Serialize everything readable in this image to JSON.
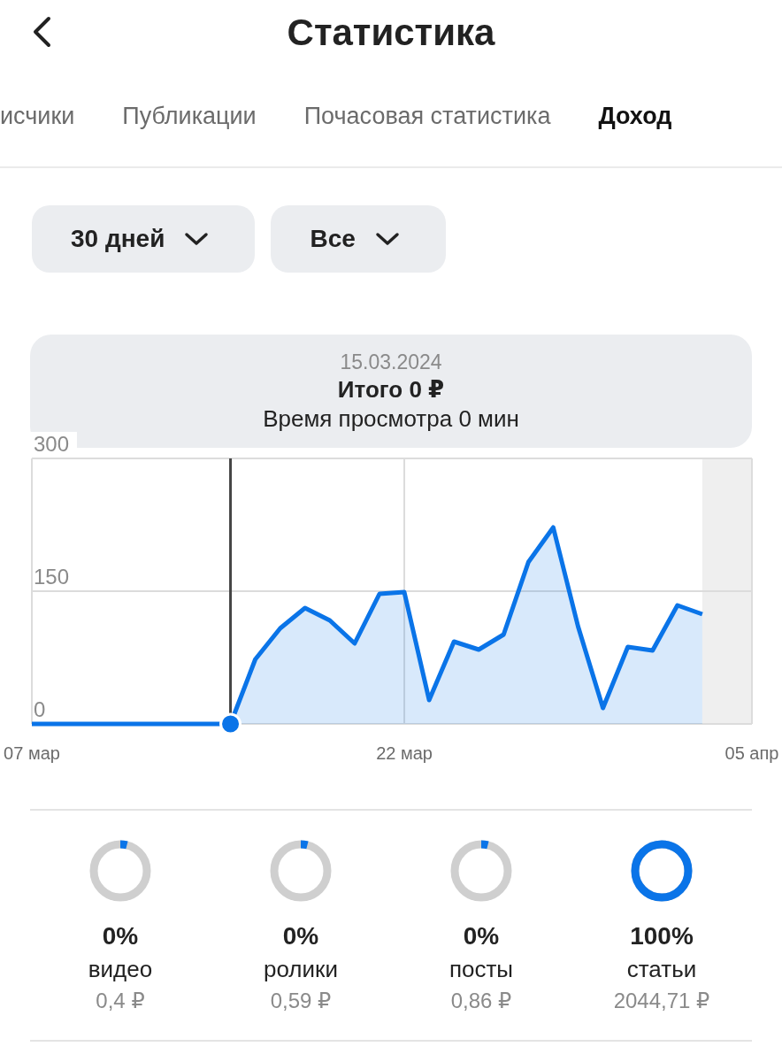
{
  "header": {
    "title": "Статистика"
  },
  "tabs": [
    {
      "label": "исчики",
      "selected": false
    },
    {
      "label": "Публикации",
      "selected": false
    },
    {
      "label": "Почасовая статистика",
      "selected": false
    },
    {
      "label": "Доход",
      "selected": true
    }
  ],
  "filters": [
    {
      "label": "30 дней"
    },
    {
      "label": "Все"
    }
  ],
  "summary": {
    "date": "15.03.2024",
    "total": "Итого 0 ₽",
    "watch_time": "Время просмотра 0 мин"
  },
  "chart": {
    "chart_data": {
      "type": "area",
      "categories": [
        "07 мар",
        null,
        null,
        null,
        null,
        null,
        null,
        null,
        null,
        null,
        null,
        null,
        null,
        null,
        null,
        "22 мар",
        null,
        null,
        null,
        null,
        null,
        null,
        null,
        null,
        null,
        null,
        null,
        null,
        null,
        "05 апр"
      ],
      "series": [
        {
          "color": "#0a74e8",
          "values": [
            0,
            0,
            0,
            0,
            0,
            0,
            0,
            0,
            0,
            73,
            108,
            131,
            117,
            91,
            147,
            149,
            27,
            93,
            84,
            101,
            183,
            222,
            110,
            18,
            87,
            83,
            134,
            124,
            null,
            null
          ]
        }
      ],
      "ylim": [
        0,
        300
      ],
      "yticks": [
        0,
        150,
        300
      ]
    }
  },
  "breakdown": [
    {
      "percent": "0%",
      "name": "видео",
      "amount": "0,4 ₽",
      "level": 0.0002
    },
    {
      "percent": "0%",
      "name": "ролики",
      "amount": "0,59 ₽",
      "level": 0.0003
    },
    {
      "percent": "0%",
      "name": "посты",
      "amount": "0,86 ₽",
      "level": 0.0004
    },
    {
      "percent": "100%",
      "name": "статьи",
      "amount": "2044,71 ₽",
      "level": 1
    }
  ]
}
